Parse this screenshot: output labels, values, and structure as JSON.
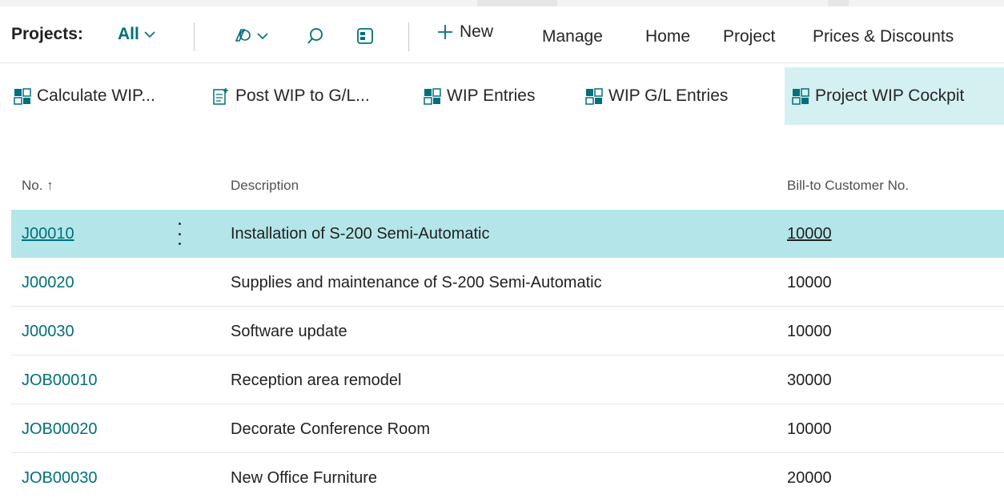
{
  "header": {
    "title": "Projects:",
    "filter_label": "All"
  },
  "menu": {
    "new_label": "New",
    "items": [
      "Manage",
      "Home",
      "Project",
      "Prices & Discounts"
    ]
  },
  "promoted_actions": [
    {
      "label": "Calculate WIP...",
      "icon": "calculate-icon",
      "active": false
    },
    {
      "label": "Post WIP to G/L...",
      "icon": "post-document-icon",
      "active": false
    },
    {
      "label": "WIP Entries",
      "icon": "entries-icon",
      "active": false
    },
    {
      "label": "WIP G/L Entries",
      "icon": "gl-entries-icon",
      "active": false
    },
    {
      "label": "Project WIP Cockpit",
      "icon": "cockpit-icon",
      "active": true
    }
  ],
  "table": {
    "columns": {
      "no": "No. ↑",
      "description": "Description",
      "customer": "Bill-to Customer No."
    },
    "rows": [
      {
        "no": "J00010",
        "description": "Installation of S-200 Semi-Automatic",
        "customer": "10000",
        "selected": true
      },
      {
        "no": "J00020",
        "description": "Supplies and maintenance of S-200 Semi-Automatic",
        "customer": "10000",
        "selected": false
      },
      {
        "no": "J00030",
        "description": "Software update",
        "customer": "10000",
        "selected": false
      },
      {
        "no": "JOB00010",
        "description": "Reception area remodel",
        "customer": "30000",
        "selected": false
      },
      {
        "no": "JOB00020",
        "description": "Decorate Conference Room",
        "customer": "10000",
        "selected": false
      },
      {
        "no": "JOB00030",
        "description": "New Office Furniture",
        "customer": "20000",
        "selected": false
      }
    ]
  },
  "colors": {
    "accent": "#00707a",
    "selected_row": "#b4e6e9",
    "active_action": "#d5f0f1"
  }
}
